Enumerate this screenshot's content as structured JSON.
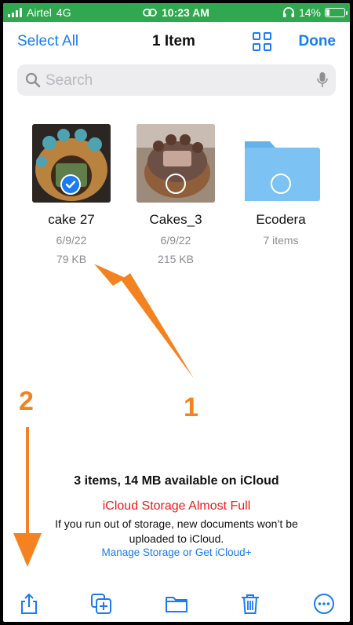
{
  "status_bar": {
    "carrier": "Airtel",
    "network": "4G",
    "time": "10:23 AM",
    "battery": "14%"
  },
  "nav": {
    "select_all": "Select All",
    "title": "1 Item",
    "done": "Done"
  },
  "search": {
    "placeholder": "Search"
  },
  "items": [
    {
      "name": "cake 27",
      "date": "6/9/22",
      "size": "79 KB",
      "selected": true
    },
    {
      "name": "Cakes_3",
      "date": "6/9/22",
      "size": "215 KB",
      "selected": false
    },
    {
      "name": "Ecodera",
      "date": "7 items",
      "size": "",
      "selected": false
    }
  ],
  "annotations": {
    "step1": "1",
    "step2": "2"
  },
  "storage": {
    "summary": "3 items, 14 MB available on iCloud",
    "warning": "iCloud Storage Almost Full",
    "body": "If you run out of storage, new documents won’t be uploaded to iCloud.",
    "link": "Manage Storage or Get iCloud+"
  },
  "toolbar": [
    "share-icon",
    "duplicate-icon",
    "folder-icon",
    "trash-icon",
    "more-icon"
  ],
  "colors": {
    "accent": "#1a7bf5",
    "status_bar": "#2fa84f",
    "warning": "#f01818",
    "annotation": "#f58220"
  }
}
